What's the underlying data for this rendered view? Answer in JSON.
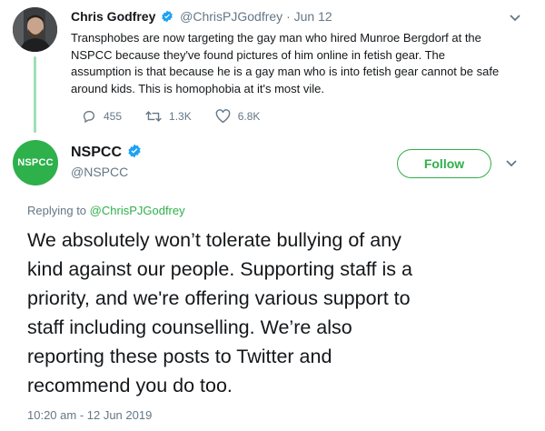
{
  "parent_tweet": {
    "name": "Chris Godfrey",
    "handle": "@ChrisPJGodfrey",
    "separator": "·",
    "date": "Jun 12",
    "body_lines": [
      "Transphobes are now targeting the gay man who hired Munroe Bergdorf at the",
      "NSPCC because they've found pictures of him online in fetish gear.  The",
      "assumption is that because he is a gay man who is into fetish gear cannot be safe",
      "around kids. This is homophobia at it's most vile."
    ],
    "stats": {
      "replies": "455",
      "retweets": "1.3K",
      "likes": "6.8K"
    }
  },
  "main_tweet": {
    "avatar_text": "NSPCC",
    "name": "NSPCC",
    "handle": "@NSPCC",
    "follow_label": "Follow",
    "replying_prefix": "Replying to",
    "replying_handle": "@ChrisPJGodfrey",
    "body_lines": [
      "We absolutely won’t tolerate bullying of any",
      "kind against our people. Supporting staff is a",
      "priority, and we're offering various support to",
      "staff including counselling. We’re also",
      "reporting these posts to Twitter and",
      "recommend you do too."
    ],
    "timestamp": "10:20 am - 12 Jun 2019"
  },
  "colors": {
    "brand": "#2eb04b",
    "verified": "#1da1f2",
    "muted": "#657786"
  },
  "icons": [
    "verified-badge-icon",
    "chevron-down-icon",
    "reply-icon",
    "retweet-icon",
    "like-icon"
  ]
}
